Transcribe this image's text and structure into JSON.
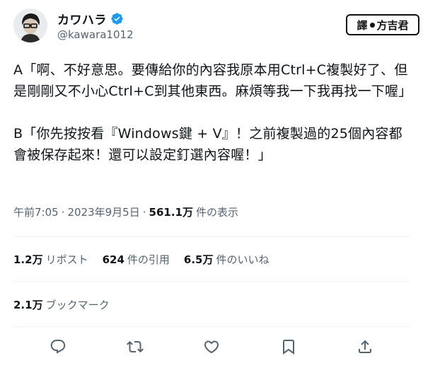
{
  "author": {
    "display_name": "カワハラ",
    "handle": "@kawara1012",
    "verified": true,
    "avatar_icon": "avatar-person-with-glasses"
  },
  "watermark": {
    "left_text": "譯",
    "right_text": "方吉君"
  },
  "tweet": {
    "paragraph_1": "A「啊、不好意思。要傳給你的內容我原本用Ctrl+C複製好了、但是剛剛又不小心Ctrl+C到其他東西。麻煩等我一下我再找一下喔」",
    "paragraph_2": "B「你先按按看『Windows鍵 + V』！之前複製過的25個內容都會被保存起來！還可以設定釘選內容喔！」"
  },
  "meta": {
    "time": "午前7:05",
    "sep1": "·",
    "date": "2023年9月5日",
    "sep2": "·",
    "views_count": "561.1万",
    "views_label": "件の表示"
  },
  "stats": {
    "reposts_count": "1.2万",
    "reposts_label": "リポスト",
    "quotes_count": "624",
    "quotes_label": "件の引用",
    "likes_count": "6.5万",
    "likes_label": "件のいいね"
  },
  "bookmarks": {
    "count": "2.1万",
    "label": "ブックマーク"
  },
  "actions": [
    "reply-icon",
    "repost-icon",
    "like-icon",
    "bookmark-icon",
    "share-icon"
  ],
  "colors": {
    "text": "#0f1419",
    "secondary": "#536471",
    "verified": "#1d9bf0",
    "divider": "#eff3f4"
  }
}
